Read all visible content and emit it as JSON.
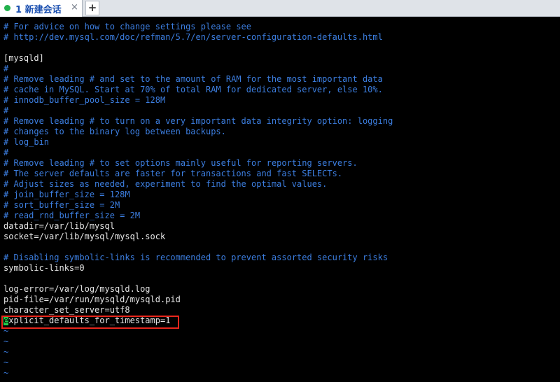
{
  "tabs": [
    {
      "label": "1 新建会话",
      "status_color": "#22b14c"
    }
  ],
  "tab_add_label": "+",
  "tab_close_label": "×",
  "editor": {
    "lines": [
      {
        "text": "# For advice on how to change settings please see",
        "kind": "comment"
      },
      {
        "text": "# http://dev.mysql.com/doc/refman/5.7/en/server-configuration-defaults.html",
        "kind": "comment"
      },
      {
        "text": "",
        "kind": "normal"
      },
      {
        "text": "[mysqld]",
        "kind": "normal"
      },
      {
        "text": "#",
        "kind": "comment"
      },
      {
        "text": "# Remove leading # and set to the amount of RAM for the most important data",
        "kind": "comment"
      },
      {
        "text": "# cache in MySQL. Start at 70% of total RAM for dedicated server, else 10%.",
        "kind": "comment"
      },
      {
        "text": "# innodb_buffer_pool_size = 128M",
        "kind": "comment"
      },
      {
        "text": "#",
        "kind": "comment"
      },
      {
        "text": "# Remove leading # to turn on a very important data integrity option: logging",
        "kind": "comment"
      },
      {
        "text": "# changes to the binary log between backups.",
        "kind": "comment"
      },
      {
        "text": "# log_bin",
        "kind": "comment"
      },
      {
        "text": "#",
        "kind": "comment"
      },
      {
        "text": "# Remove leading # to set options mainly useful for reporting servers.",
        "kind": "comment"
      },
      {
        "text": "# The server defaults are faster for transactions and fast SELECTs.",
        "kind": "comment"
      },
      {
        "text": "# Adjust sizes as needed, experiment to find the optimal values.",
        "kind": "comment"
      },
      {
        "text": "# join_buffer_size = 128M",
        "kind": "comment"
      },
      {
        "text": "# sort_buffer_size = 2M",
        "kind": "comment"
      },
      {
        "text": "# read_rnd_buffer_size = 2M",
        "kind": "comment"
      },
      {
        "text": "datadir=/var/lib/mysql",
        "kind": "normal"
      },
      {
        "text": "socket=/var/lib/mysql/mysql.sock",
        "kind": "normal"
      },
      {
        "text": "",
        "kind": "normal"
      },
      {
        "text": "# Disabling symbolic-links is recommended to prevent assorted security risks",
        "kind": "comment"
      },
      {
        "text": "symbolic-links=0",
        "kind": "normal"
      },
      {
        "text": "",
        "kind": "normal"
      },
      {
        "text": "log-error=/var/log/mysqld.log",
        "kind": "normal"
      },
      {
        "text": "pid-file=/var/run/mysqld/mysqld.pid",
        "kind": "normal"
      },
      {
        "text": "character_set_server=utf8",
        "kind": "normal"
      },
      {
        "text": "explicit_defaults_for_timestamp=1",
        "kind": "cursor",
        "highlighted": true
      },
      {
        "text": "~",
        "kind": "tilde"
      },
      {
        "text": "~",
        "kind": "tilde"
      },
      {
        "text": "~",
        "kind": "tilde"
      },
      {
        "text": "~",
        "kind": "tilde"
      },
      {
        "text": "~",
        "kind": "tilde"
      }
    ],
    "cursor_line": 28,
    "cursor_color": "#22d14c",
    "highlight_color": "#e8261c",
    "comment_color": "#3c7ee0",
    "text_color": "#e6e6e6"
  }
}
